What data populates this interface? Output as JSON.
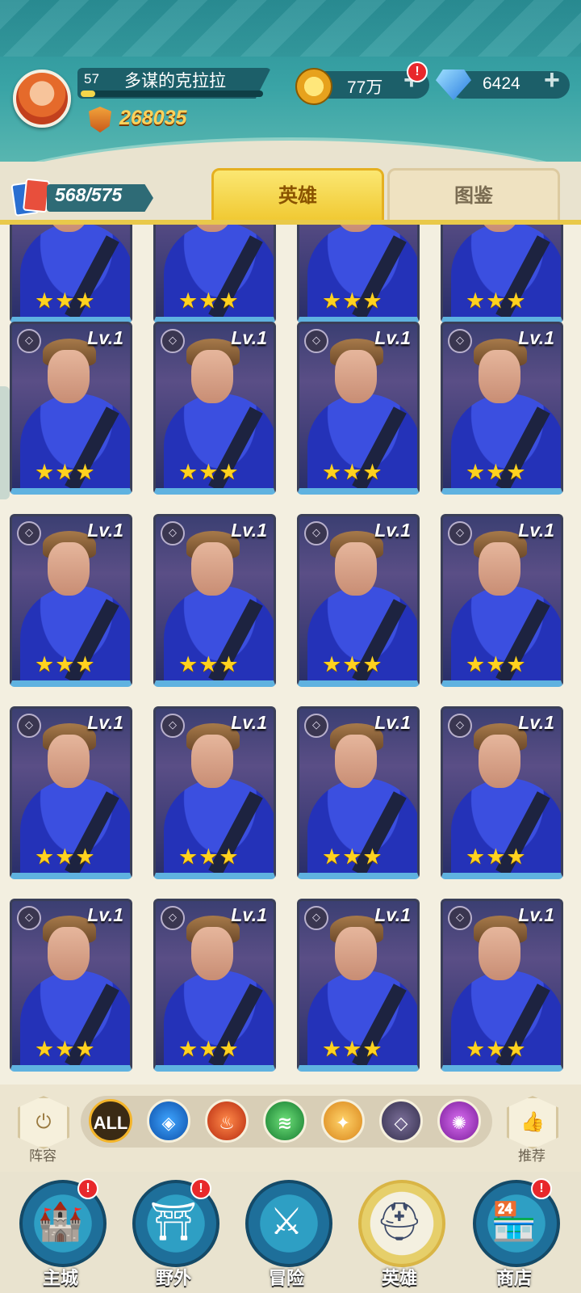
{
  "player": {
    "level": "57",
    "name": "多谋的克拉拉",
    "power": "268035",
    "gold": "77万",
    "gems": "6424"
  },
  "roster": {
    "count": "568/575"
  },
  "tabs": {
    "heroes": "英雄",
    "codex": "图鉴"
  },
  "hero_card": {
    "level": "Lv.1",
    "stars": "★★★"
  },
  "filter": {
    "lineup_label": "阵容",
    "all_label": "ALL",
    "recommend_label": "推荐"
  },
  "nav": {
    "items": [
      {
        "label": "主城",
        "badge": "!"
      },
      {
        "label": "野外",
        "badge": "!"
      },
      {
        "label": "冒险",
        "badge": ""
      },
      {
        "label": "英雄",
        "badge": ""
      },
      {
        "label": "商店",
        "badge": "!"
      }
    ]
  },
  "colors": {
    "accent": "#f0c830",
    "teal": "#2a8f96",
    "card_border": "#5fb2e0"
  },
  "icons": {
    "gold": "coin-icon",
    "gems": "diamond-icon",
    "roster": "cards-icon",
    "power": "power-shield-icon"
  }
}
